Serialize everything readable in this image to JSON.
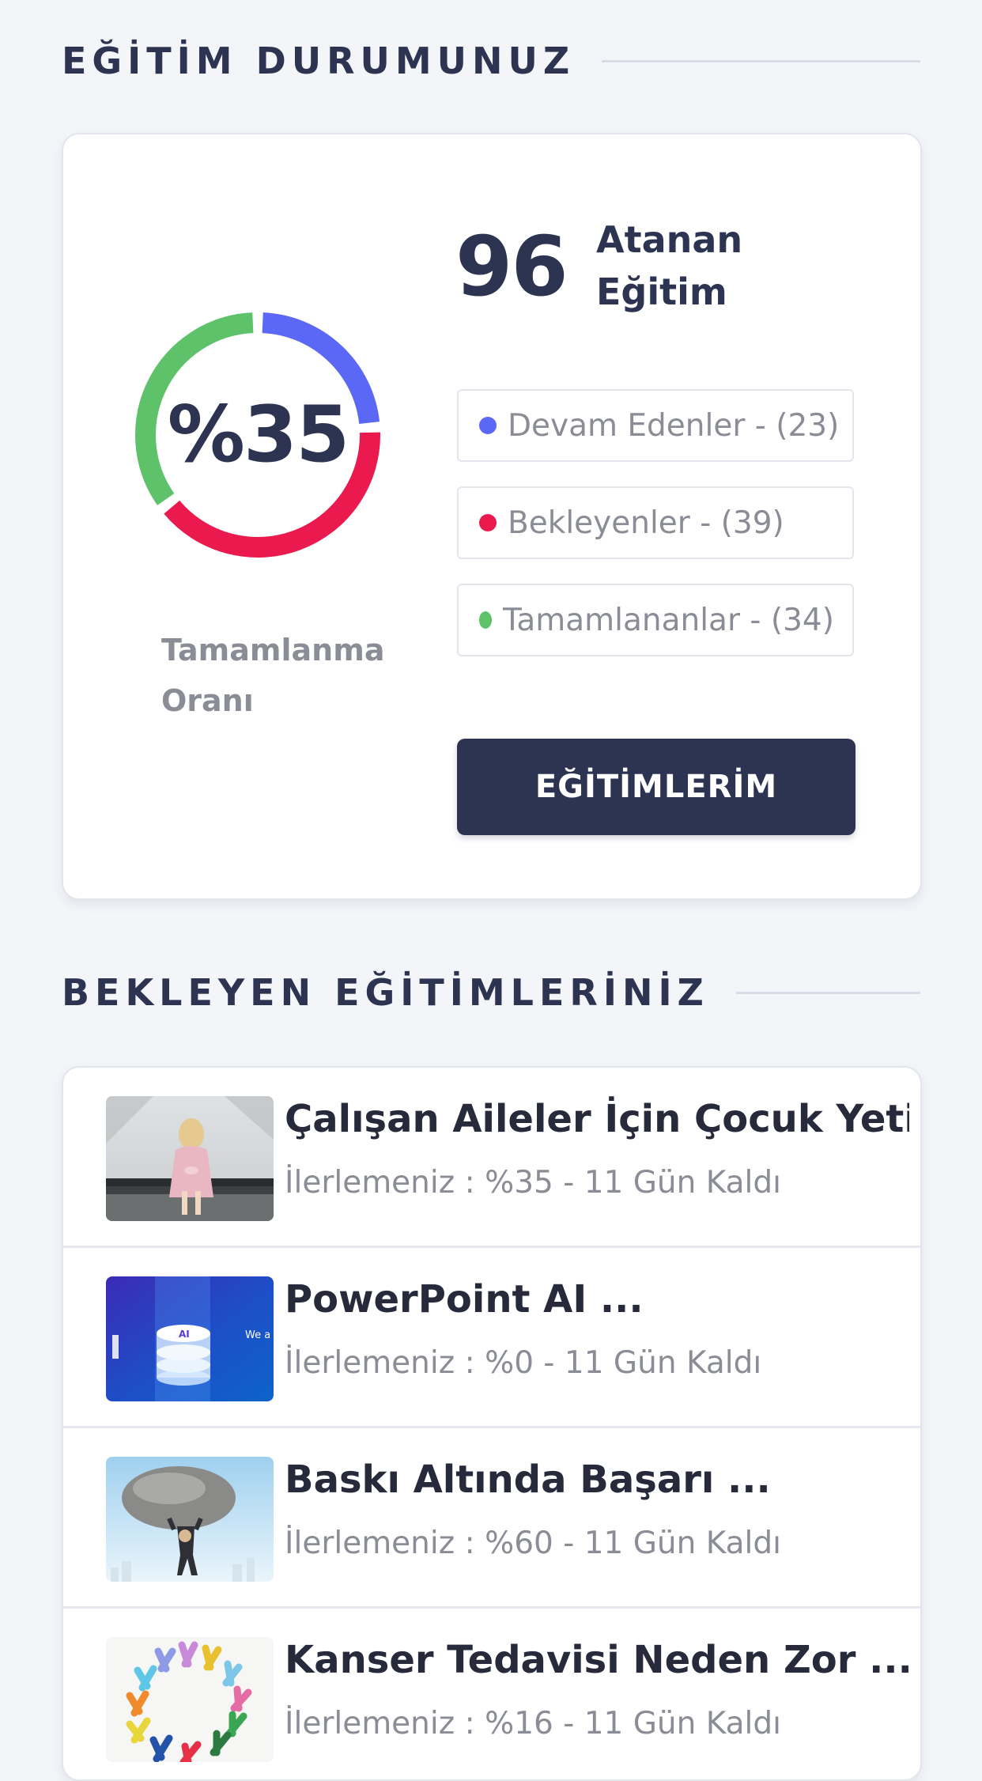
{
  "status_section": {
    "title": "EĞİTİM DURUMUNUZ",
    "completion_value": "%35",
    "completion_fraction": 0.35,
    "completion_label": "Tamamlanma Oranı",
    "assigned_count": "96",
    "assigned_label": "Atanan Eğitim",
    "legend": [
      {
        "label": "Devam Edenler - (23)",
        "count": 23,
        "color": "#5b68f6"
      },
      {
        "label": "Bekleyenler - (39)",
        "count": 39,
        "color": "#ea1a4f"
      },
      {
        "label": "Tamamlananlar - (34)",
        "count": 34,
        "color": "#5ec26a"
      }
    ],
    "button_label": "EĞİTİMLERİM"
  },
  "pending_section": {
    "title": "BEKLEYEN EĞİTİMLERİNİZ",
    "items": [
      {
        "title": "Çalışan Aileler İçin Çocuk Yeti ...",
        "subtitle": "İlerlemeniz : %35 - 11 Gün Kaldı",
        "image": "girl-at-window-image"
      },
      {
        "title": "PowerPoint AI ...",
        "subtitle": "İlerlemeniz : %0 - 11 Gün Kaldı",
        "image": "ai-stack-image",
        "image_text": "We a Shap Worl Tomo"
      },
      {
        "title": "Baskı Altında Başarı ...",
        "subtitle": "İlerlemeniz : %60 - 11 Gün Kaldı",
        "image": "man-holding-boulder-image"
      },
      {
        "title": "Kanser Tedavisi Neden Zor ...",
        "subtitle": "İlerlemeniz : %16 - 11 Gün Kaldı",
        "image": "awareness-ribbons-image"
      }
    ]
  }
}
